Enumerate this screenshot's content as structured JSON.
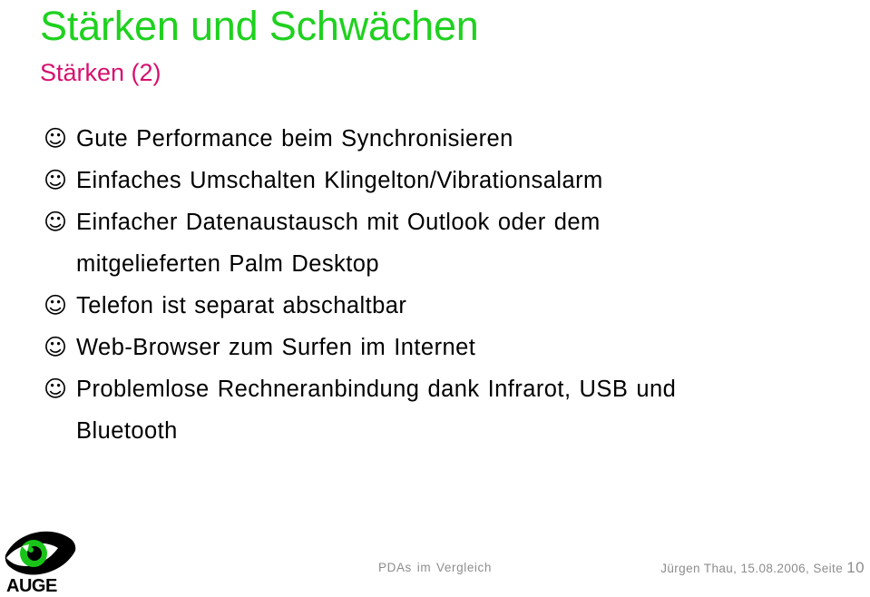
{
  "slide": {
    "title": "Stärken und Schwächen",
    "subtitle": "Stärken (2)",
    "title_color": "#1fd11f",
    "subtitle_color": "#d6106e",
    "background_color": "#ffffff"
  },
  "bullets": {
    "marker_glyph": "☺",
    "marker_icon_name": "smiley-face-bullet-icon",
    "items": [
      {
        "text": "Gute Performance beim Synchronisieren",
        "continuation": ""
      },
      {
        "text": "Einfaches Umschalten Klingelton/Vibrationsalarm",
        "continuation": ""
      },
      {
        "text": "Einfacher Datenaustausch mit Outlook oder dem",
        "continuation": "mitgelieferten Palm Desktop"
      },
      {
        "text": "Telefon ist separat abschaltbar",
        "continuation": ""
      },
      {
        "text": "Web-Browser zum Surfen im Internet",
        "continuation": ""
      },
      {
        "text": "Problemlose Rechneranbindung dank Infrarot, USB und",
        "continuation": "Bluetooth"
      }
    ]
  },
  "footer": {
    "logo_text": "AUGE",
    "logo_iris_color": "#19c419",
    "logo_body_color": "#000000",
    "center_text": "PDAs im Vergleich",
    "right_text": "Jürgen Thau, 15.08.2006, Seite",
    "page_number": "10",
    "text_color": "#8d8d8d"
  }
}
